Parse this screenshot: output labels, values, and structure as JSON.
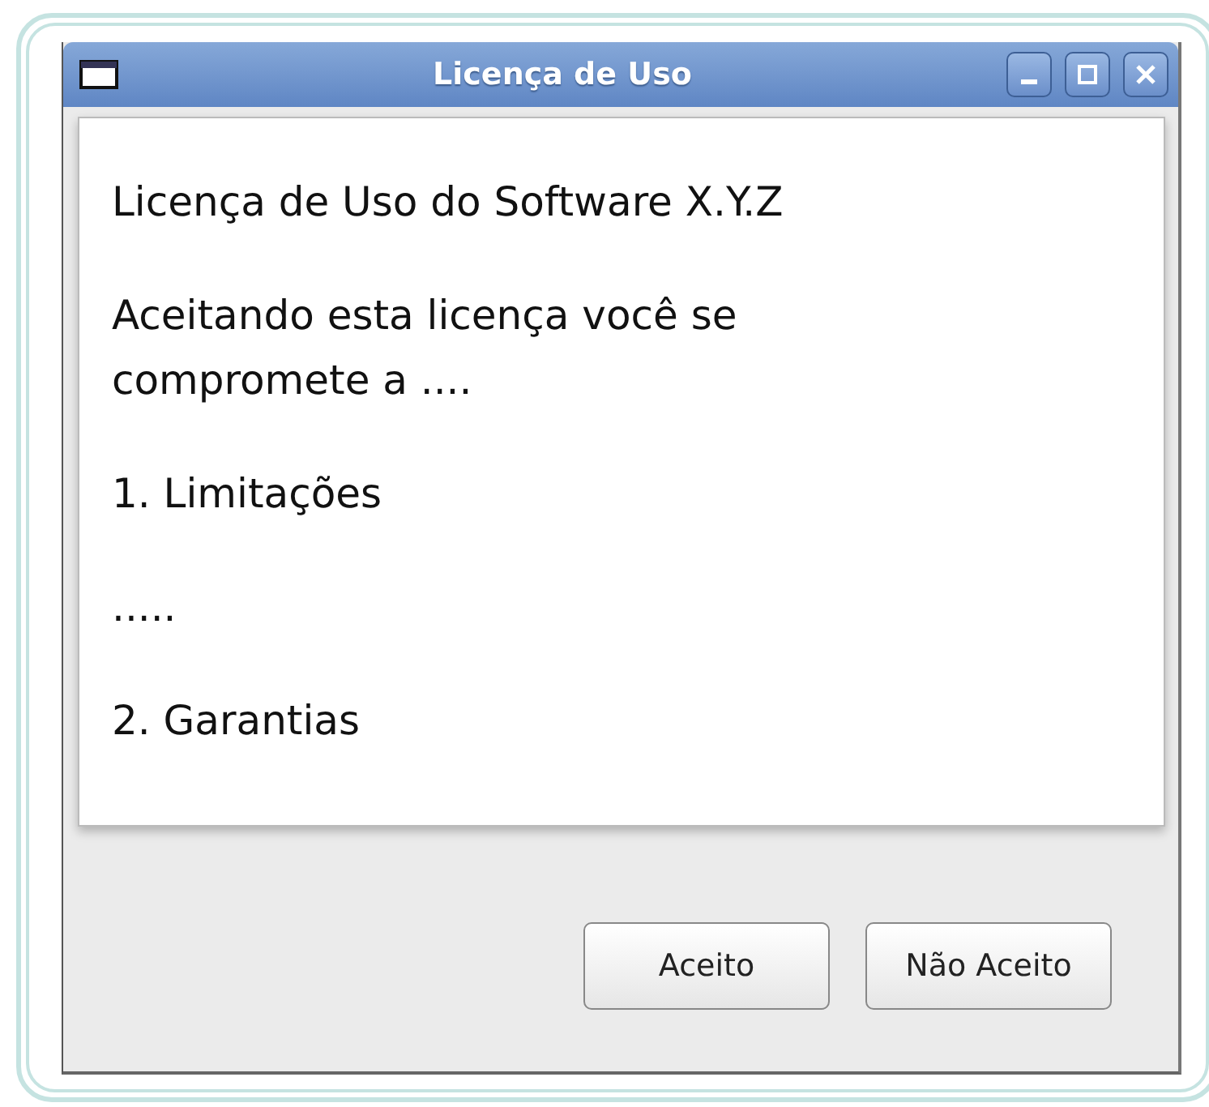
{
  "window": {
    "title": "Licença de Uso"
  },
  "paragraphs": [
    "Licença de Uso do Software X.Y.Z",
    "Aceitando esta licença você se compromete a ....",
    "1. Limitações",
    ".....",
    "2. Garantias"
  ],
  "buttons": [
    "Aceito",
    "Não Aceito"
  ]
}
